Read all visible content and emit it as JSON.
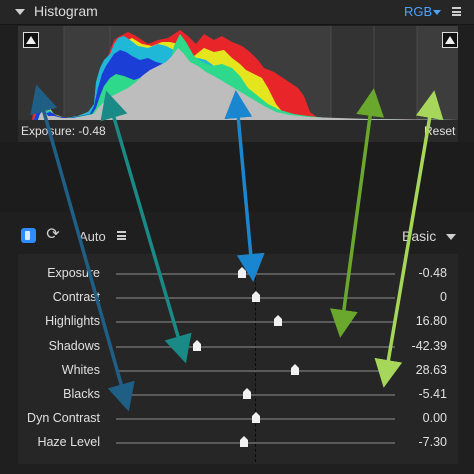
{
  "histogram_panel": {
    "title": "Histogram",
    "channel": "RGB",
    "exposure_readout": "Exposure: -0.48",
    "reset_label": "Reset",
    "shadow_clip_icon": "triangle-up-icon",
    "highlight_clip_icon": "triangle-up-icon"
  },
  "basic_panel": {
    "auto_label": "Auto",
    "preset_label": "Basic",
    "sliders": [
      {
        "label": "Exposure",
        "value": "-0.48",
        "position": 0.45
      },
      {
        "label": "Contrast",
        "value": "0",
        "position": 0.5
      },
      {
        "label": "Highlights",
        "value": "16.80",
        "position": 0.58
      },
      {
        "label": "Shadows",
        "value": "-42.39",
        "position": 0.29
      },
      {
        "label": "Whites",
        "value": "28.63",
        "position": 0.64
      },
      {
        "label": "Blacks",
        "value": "-5.41",
        "position": 0.47
      },
      {
        "label": "Dyn Contrast",
        "value": "0.00",
        "position": 0.5
      },
      {
        "label": "Haze Level",
        "value": "-7.30",
        "position": 0.46
      }
    ]
  },
  "colors": {
    "accent": "#4aa3ff",
    "arrow_dark": "#1f5f86",
    "arrow_teal": "#1a8a86",
    "arrow_blue": "#1a86cf",
    "arrow_green": "#6aa82d",
    "arrow_light_green": "#a6d65a"
  }
}
